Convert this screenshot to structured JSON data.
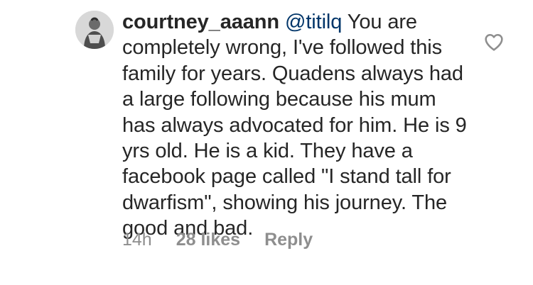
{
  "comment": {
    "username": "courtney_aaann",
    "mention": "@titilq",
    "text": "You are completely wrong, I've followed this family for years. Quadens always had a large following because his mum has always advocated for him. He is 9 yrs old. He is a kid. They have a facebook page called \"I stand tall for dwarfism\", showing his journey. The good and bad.",
    "timestamp": "14h",
    "likes": "28 likes",
    "reply_label": "Reply",
    "like_icon": "heart-outline-icon",
    "avatar_icon": "profile-avatar"
  },
  "colors": {
    "text": "#262626",
    "mention": "#003569",
    "meta": "#8e8e8e",
    "background": "#ffffff"
  }
}
